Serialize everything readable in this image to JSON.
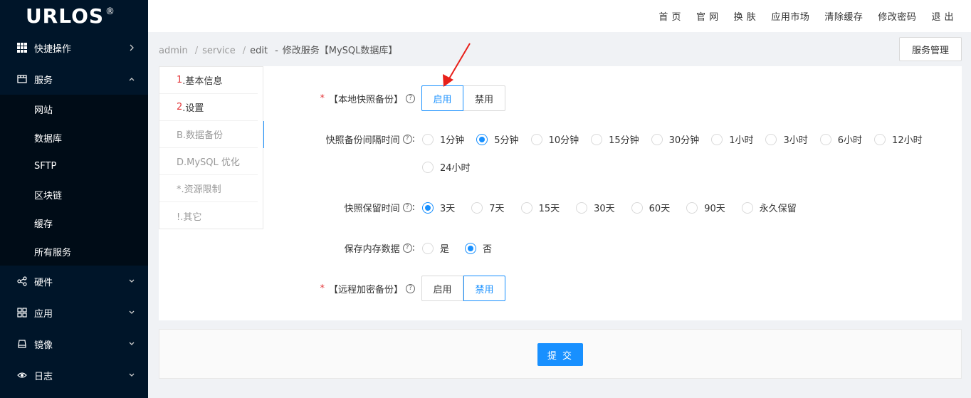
{
  "logo": {
    "text": "URLOS",
    "mark": "®"
  },
  "sidebar": {
    "items": [
      {
        "label": "快捷操作",
        "icon": "grid-icon"
      },
      {
        "label": "服务",
        "icon": "store-icon"
      },
      {
        "label": "硬件",
        "icon": "share-icon"
      },
      {
        "label": "应用",
        "icon": "apps-icon"
      },
      {
        "label": "镜像",
        "icon": "drive-icon"
      },
      {
        "label": "日志",
        "icon": "eye-icon"
      }
    ],
    "submenu": [
      "网站",
      "数据库",
      "SFTP",
      "区块链",
      "缓存",
      "所有服务"
    ]
  },
  "header": {
    "links": [
      "首 页",
      "官 网",
      "换 肤",
      "应用市场",
      "清除缓存",
      "修改密码",
      "退 出"
    ]
  },
  "breadcrumb": {
    "parts": [
      "admin",
      "service",
      "edit"
    ],
    "title": "修改服务【MySQL数据库】"
  },
  "service_manage_button": "服务管理",
  "steps": [
    {
      "num": "1",
      "label": ".基本信息"
    },
    {
      "num": "2",
      "label": ".设置"
    },
    {
      "num": "",
      "label": "B.数据备份"
    },
    {
      "num": "",
      "label": "D.MySQL 优化"
    },
    {
      "num": "",
      "label": "*.资源限制"
    },
    {
      "num": "",
      "label": "!.其它"
    }
  ],
  "form": {
    "local_backup": {
      "label": "【本地快照备份】",
      "options": [
        "启用",
        "禁用"
      ],
      "selected": "启用"
    },
    "interval": {
      "label": "快照备份间隔时间",
      "options": [
        "1分钟",
        "5分钟",
        "10分钟",
        "15分钟",
        "30分钟",
        "1小时",
        "3小时",
        "6小时",
        "12小时",
        "24小时"
      ],
      "selected": "5分钟"
    },
    "retention": {
      "label": "快照保留时间",
      "options": [
        "3天",
        "7天",
        "15天",
        "30天",
        "60天",
        "90天",
        "永久保留"
      ],
      "selected": "3天"
    },
    "save_memory": {
      "label": "保存内存数据",
      "options": [
        "是",
        "否"
      ],
      "selected": "否"
    },
    "remote_backup": {
      "label": "【远程加密备份】",
      "options": [
        "启用",
        "禁用"
      ],
      "selected": "禁用"
    }
  },
  "submit_label": "提 交",
  "colors": {
    "primary": "#1890ff",
    "sidebar": "#001529",
    "required": "#e4393c"
  }
}
